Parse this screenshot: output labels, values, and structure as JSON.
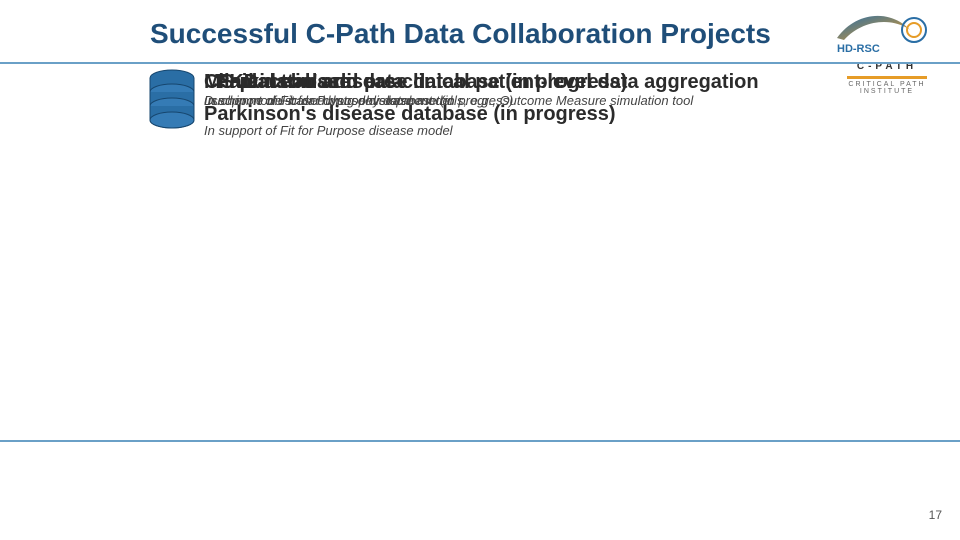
{
  "title": "Successful C-Path Data Collaboration Projects",
  "page_number": "17",
  "logo": {
    "hd_rsc": "HD-RSC",
    "cp_top": "C-PATH",
    "cp_sub": "CRITICAL PATH INSTITUTE"
  },
  "overlap": {
    "headlines": [
      "MS placebo arm data",
      "Clinical trial and pre-clinical patient-level data aggregation",
      "PKD database",
      "Parkinson's disease database (in progress)"
    ],
    "sublines": [
      "In support of Fit for Purpose disease model",
      "used in model-based drug development tools, e.g., Outcome Measure simulation tool",
      "Duchenne muscular dystrophy database (in progress)"
    ],
    "headline2": "Duchenne muscular dystrophy database (in progress)",
    "sub_bottom": "In support of Fit for Purpose disease model"
  }
}
